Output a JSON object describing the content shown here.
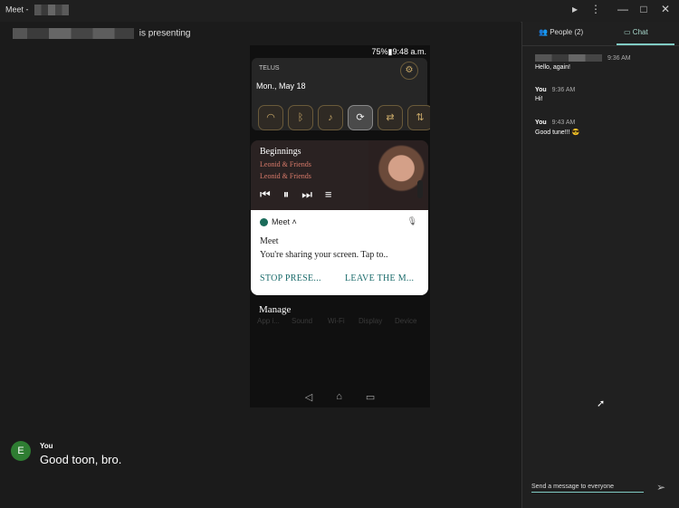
{
  "window": {
    "title": "Meet -",
    "controls": [
      "▸",
      "⋮",
      "—",
      "□",
      "✕"
    ]
  },
  "presentation": {
    "presenting_text": "is presenting",
    "phone": {
      "status_bar": "75%▮9:48 a.m.",
      "carrier": "TELUS",
      "date": "Mon., May 18",
      "toggles": [
        "wifi-icon",
        "bluetooth-icon",
        "sound-icon",
        "rotate-icon",
        "sync-icon",
        "data-icon"
      ],
      "music": {
        "song": "Beginnings",
        "artist": "Leonid & Friends",
        "album": "Leonid & Friends"
      },
      "notification": {
        "app": "Meet",
        "title": "Meet",
        "body": "You're sharing your screen. Tap to..",
        "action1": "STOP PRESE...",
        "action2": "LEAVE THE M..."
      },
      "manage_label": "Manage",
      "faded_labels": [
        "App i...",
        "Sound",
        "Wi-Fi",
        "Display",
        "Device"
      ]
    }
  },
  "self_tile": {
    "avatar_letter": "E",
    "name": "You",
    "message": "Good toon, bro."
  },
  "sidebar": {
    "tabs": {
      "people": "People (2)",
      "chat": "Chat"
    },
    "messages": [
      {
        "name": "",
        "time": "9:36 AM",
        "text": "Hello, again!"
      },
      {
        "name": "You",
        "time": "9:36 AM",
        "text": "Hi!"
      },
      {
        "name": "You",
        "time": "9:43 AM",
        "text": "Good tune!!! 😎"
      }
    ],
    "compose_placeholder": "Send a message to everyone",
    "send_icon": "➢"
  }
}
